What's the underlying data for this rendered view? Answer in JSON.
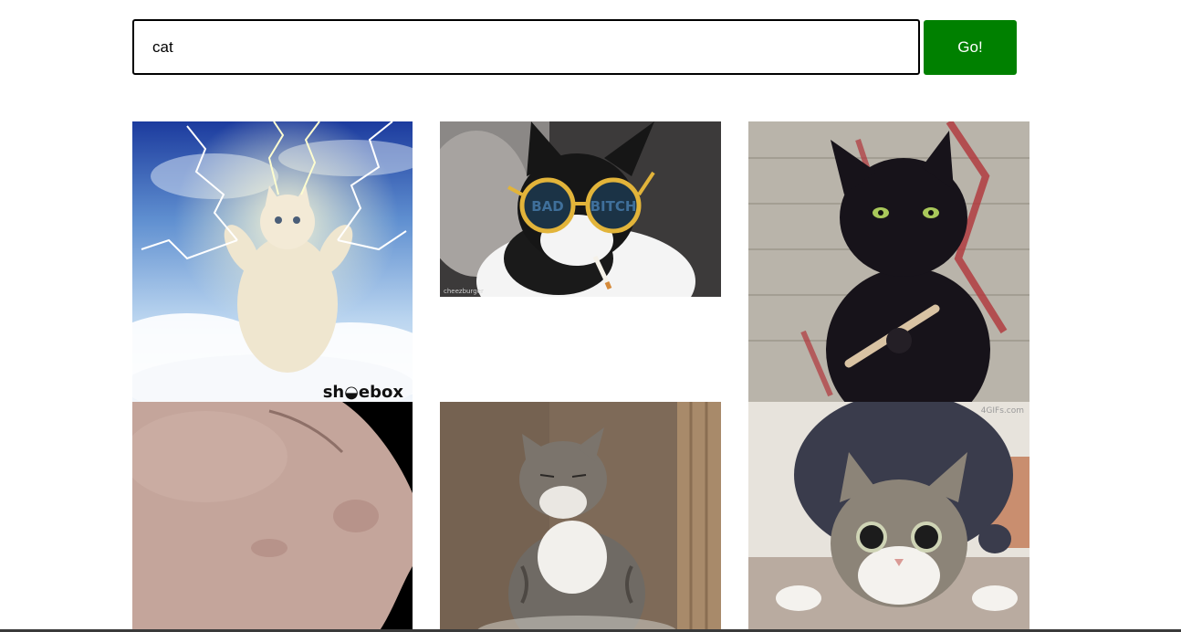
{
  "search": {
    "query": "cat",
    "button_label": "Go!"
  },
  "results": [
    {
      "subject": "white kitten with lightning in the sky",
      "watermark": "sh◒ebox"
    },
    {
      "subject": "cat wearing sunglasses with cigarette",
      "lens_left": "BAD",
      "lens_right": "BITCH",
      "watermark": "cheezburger"
    },
    {
      "subject": "black cat with nail file",
      "watermark": ""
    },
    {
      "subject": "close-up of a hand",
      "watermark": ""
    },
    {
      "subject": "tabby cat sitting in a glass bowl",
      "watermark": ""
    },
    {
      "subject": "wide-eyed tabby cat crouching",
      "watermark": "4GIFs.com"
    }
  ],
  "colors": {
    "go_button": "#008000",
    "input_border": "#000000"
  }
}
